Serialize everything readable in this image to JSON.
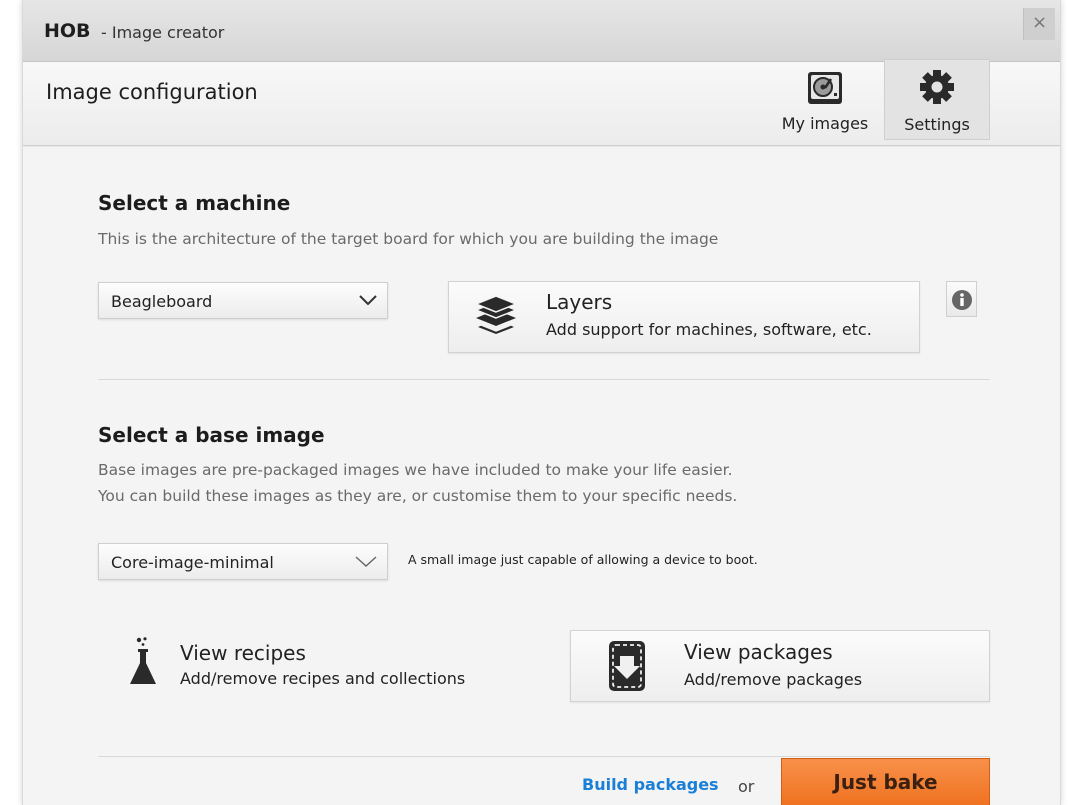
{
  "window": {
    "app_name": "HOB",
    "app_subtitle": "- Image creator",
    "close_glyph": "×"
  },
  "header": {
    "title": "Image configuration",
    "buttons": [
      {
        "label": "My images",
        "icon": "hard-drive-icon"
      },
      {
        "label": "Settings",
        "icon": "gear-icon"
      }
    ]
  },
  "machine": {
    "heading": "Select a machine",
    "description": "This is the architecture of the target board for which you are building the image",
    "selected": "Beagleboard",
    "layers": {
      "title": "Layers",
      "subtitle": "Add support for machines, software, etc.",
      "icon": "layers-icon"
    },
    "info_icon": "info-icon"
  },
  "base_image": {
    "heading": "Select a base image",
    "description_line1": "Base images are pre-packaged images we have included to make your life easier.",
    "description_line2": "You can build these images as they are, or customise them to your specific needs.",
    "selected": "Core-image-minimal",
    "selected_description": "A small image just capable of allowing a device to boot."
  },
  "recipes": {
    "title": "View recipes",
    "subtitle": "Add/remove recipes and collections",
    "icon": "flask-icon"
  },
  "packages": {
    "title": "View packages",
    "subtitle": "Add/remove packages",
    "icon": "package-download-icon"
  },
  "footer": {
    "build_packages_label": "Build packages",
    "or_label": "or",
    "just_bake_label": "Just bake"
  },
  "colors": {
    "accent_link": "#1a7fd6",
    "bake_button": "#f28034"
  }
}
